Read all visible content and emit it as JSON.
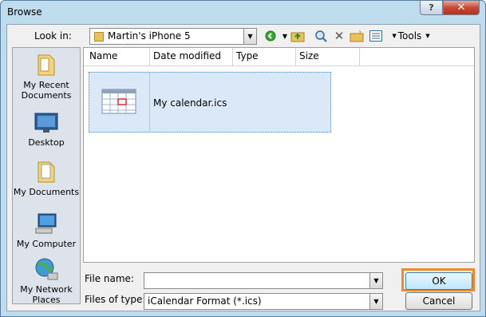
{
  "window": {
    "title": "Browse",
    "help_label": "?",
    "close_label": "✕"
  },
  "lookin": {
    "label": "Look in:",
    "value": "Martin's iPhone 5"
  },
  "toolbar": {
    "tools_label": "Tools"
  },
  "places": [
    {
      "label": "My Recent Documents",
      "icon": "recent-documents-icon"
    },
    {
      "label": "Desktop",
      "icon": "desktop-icon"
    },
    {
      "label": "My Documents",
      "icon": "my-documents-icon"
    },
    {
      "label": "My Computer",
      "icon": "computer-icon"
    },
    {
      "label": "My Network Places",
      "icon": "network-icon"
    }
  ],
  "columns": [
    "Name",
    "Date modified",
    "Type",
    "Size"
  ],
  "files": [
    {
      "name": "My calendar.ics",
      "icon": "calendar-file-icon"
    }
  ],
  "filename": {
    "label": "File name:",
    "value": ""
  },
  "filetype": {
    "label": "Files of type:",
    "value": "iCalendar Format (*.ics)"
  },
  "buttons": {
    "ok": "OK",
    "cancel": "Cancel"
  },
  "colors": {
    "highlight": "#f08a24",
    "selection": "#dbe8f8"
  }
}
